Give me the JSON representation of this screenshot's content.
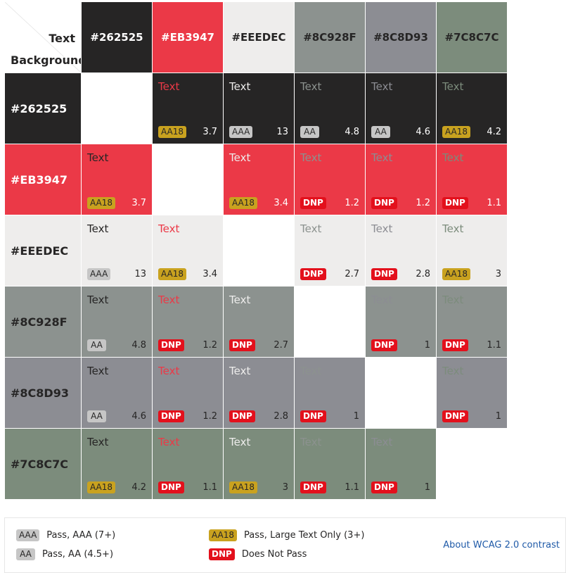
{
  "corner": {
    "text_label": "Text",
    "background_label": "Background"
  },
  "colors": [
    "#262525",
    "#EB3947",
    "#EEEDEC",
    "#8C928F",
    "#8C8D93",
    "#7C8C7C"
  ],
  "header_text_colors": [
    "#ffffff",
    "#ffffff",
    "#262525",
    "#262525",
    "#262525",
    "#262525"
  ],
  "row_text_colors": [
    "#ffffff",
    "#ffffff",
    "#262525",
    "#262525",
    "#262525",
    "#262525"
  ],
  "sample_text": "Text",
  "matrix": [
    [
      null,
      {
        "badge": "AA18",
        "ratio": "3.7"
      },
      {
        "badge": "AAA",
        "ratio": "13"
      },
      {
        "badge": "AA",
        "ratio": "4.8"
      },
      {
        "badge": "AA",
        "ratio": "4.6"
      },
      {
        "badge": "AA18",
        "ratio": "4.2"
      }
    ],
    [
      {
        "badge": "AA18",
        "ratio": "3.7"
      },
      null,
      {
        "badge": "AA18",
        "ratio": "3.4"
      },
      {
        "badge": "DNP",
        "ratio": "1.2"
      },
      {
        "badge": "DNP",
        "ratio": "1.2"
      },
      {
        "badge": "DNP",
        "ratio": "1.1"
      }
    ],
    [
      {
        "badge": "AAA",
        "ratio": "13"
      },
      {
        "badge": "AA18",
        "ratio": "3.4"
      },
      null,
      {
        "badge": "DNP",
        "ratio": "2.7"
      },
      {
        "badge": "DNP",
        "ratio": "2.8"
      },
      {
        "badge": "AA18",
        "ratio": "3"
      }
    ],
    [
      {
        "badge": "AA",
        "ratio": "4.8"
      },
      {
        "badge": "DNP",
        "ratio": "1.2"
      },
      {
        "badge": "DNP",
        "ratio": "2.7"
      },
      null,
      {
        "badge": "DNP",
        "ratio": "1"
      },
      {
        "badge": "DNP",
        "ratio": "1.1"
      }
    ],
    [
      {
        "badge": "AA",
        "ratio": "4.6"
      },
      {
        "badge": "DNP",
        "ratio": "1.2"
      },
      {
        "badge": "DNP",
        "ratio": "2.8"
      },
      {
        "badge": "DNP",
        "ratio": "1"
      },
      null,
      {
        "badge": "DNP",
        "ratio": "1"
      }
    ],
    [
      {
        "badge": "AA18",
        "ratio": "4.2"
      },
      {
        "badge": "DNP",
        "ratio": "1.1"
      },
      {
        "badge": "AA18",
        "ratio": "3"
      },
      {
        "badge": "DNP",
        "ratio": "1.1"
      },
      {
        "badge": "DNP",
        "ratio": "1"
      },
      null
    ]
  ],
  "legend": {
    "aaa_badge": "AAA",
    "aaa_text": "Pass, AAA (7+)",
    "aa_badge": "AA",
    "aa_text": "Pass, AA (4.5+)",
    "aa18_badge": "AA18",
    "aa18_text": "Pass, Large Text Only (3+)",
    "dnp_badge": "DNP",
    "dnp_text": "Does Not Pass",
    "about_link": "About WCAG 2.0 contrast"
  }
}
